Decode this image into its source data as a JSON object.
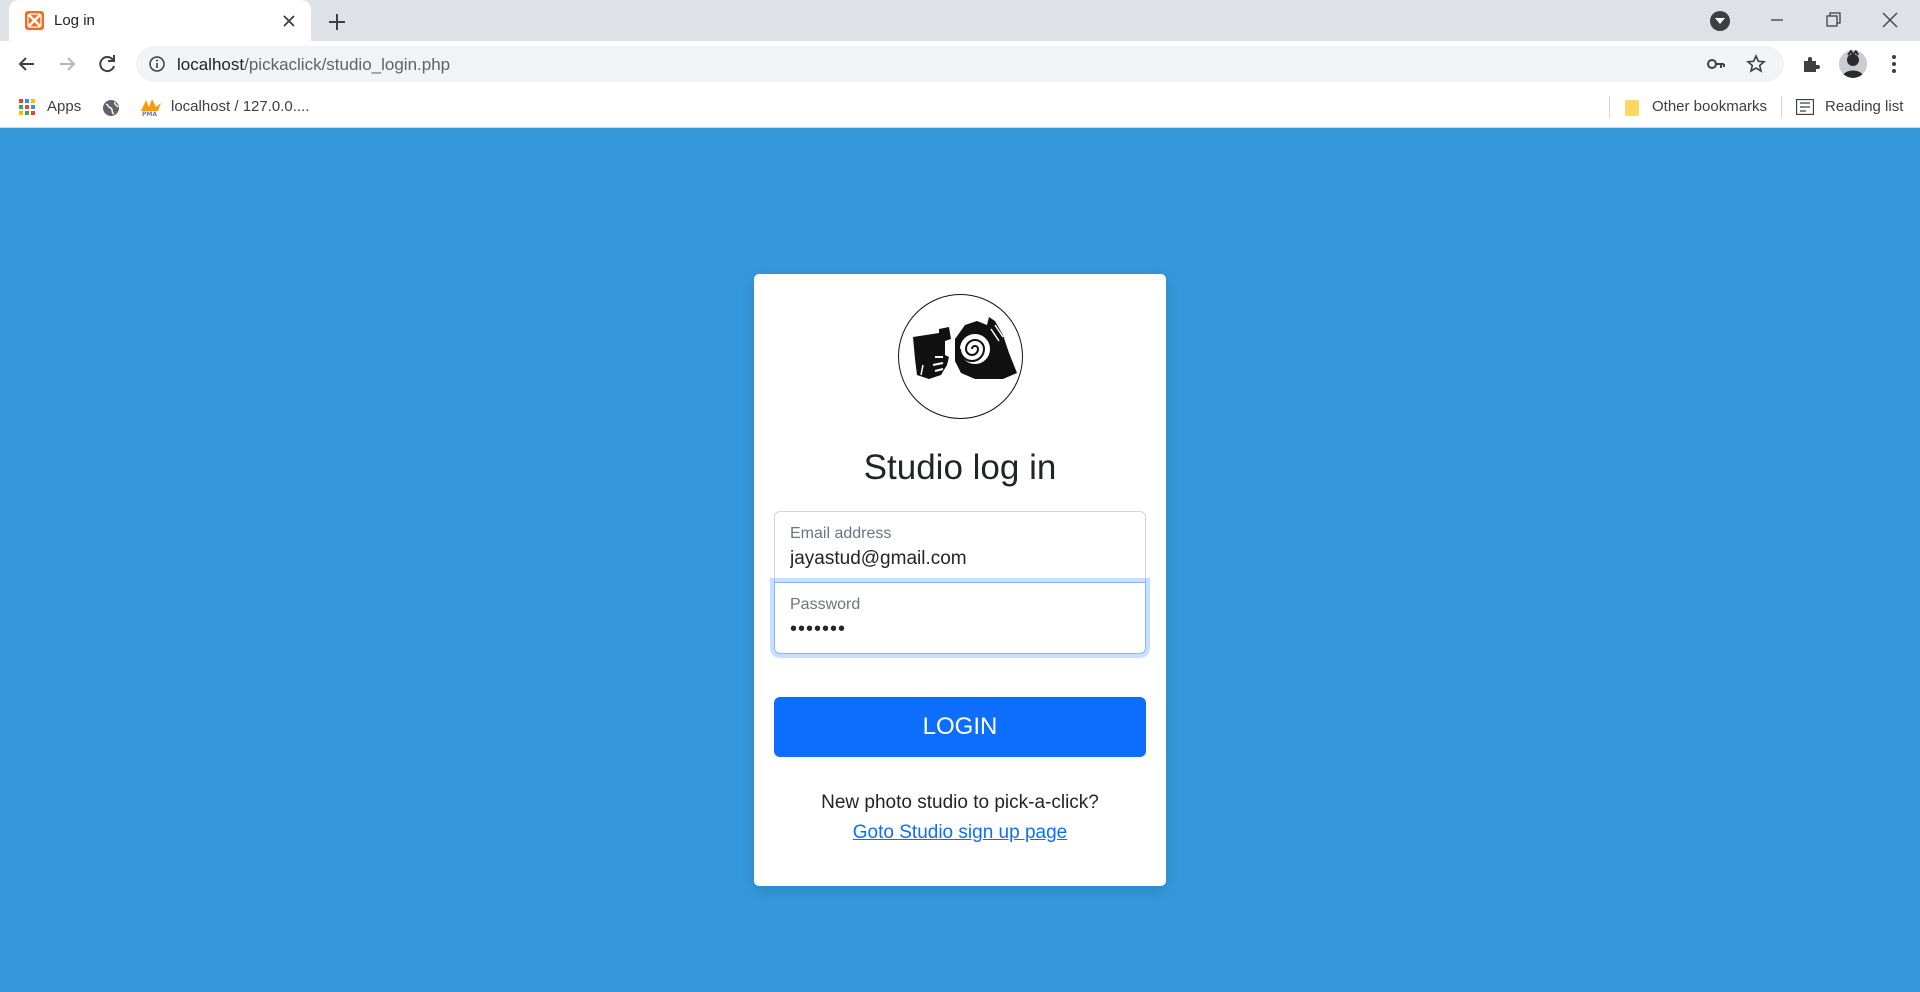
{
  "browser": {
    "tab_title": "Log in",
    "url_host": "localhost",
    "url_path": "/pickaclick/studio_login.php",
    "bookmarks": {
      "apps_label": "Apps",
      "pma_label": "localhost / 127.0.0....",
      "other_label": "Other bookmarks",
      "reading_list_label": "Reading list"
    }
  },
  "page": {
    "heading": "Studio log in",
    "email": {
      "label": "Email address",
      "value": "jayastud@gmail.com"
    },
    "password": {
      "label": "Password",
      "value": "•••••••"
    },
    "login_button": "LOGIN",
    "signup_prompt": "New photo studio to pick-a-click?",
    "signup_link": "Goto Studio sign up page"
  },
  "colors": {
    "page_background": "#3498db",
    "primary_button": "#0d6efd",
    "link": "#0d6efd",
    "tab_favicon": "#f26b21"
  },
  "icons": [
    "xampp-favicon-icon",
    "close-icon",
    "plus-icon",
    "profile-dropdown-icon",
    "minimize-icon",
    "restore-icon",
    "window-close-icon",
    "back-arrow-icon",
    "forward-arrow-icon",
    "reload-icon",
    "info-icon",
    "key-icon",
    "star-icon",
    "puzzle-icon",
    "kebab-menu-icon",
    "apps-grid-icon",
    "globe-icon",
    "phpmyadmin-icon",
    "folder-icon",
    "reading-list-icon",
    "camera-hands-logo"
  ]
}
